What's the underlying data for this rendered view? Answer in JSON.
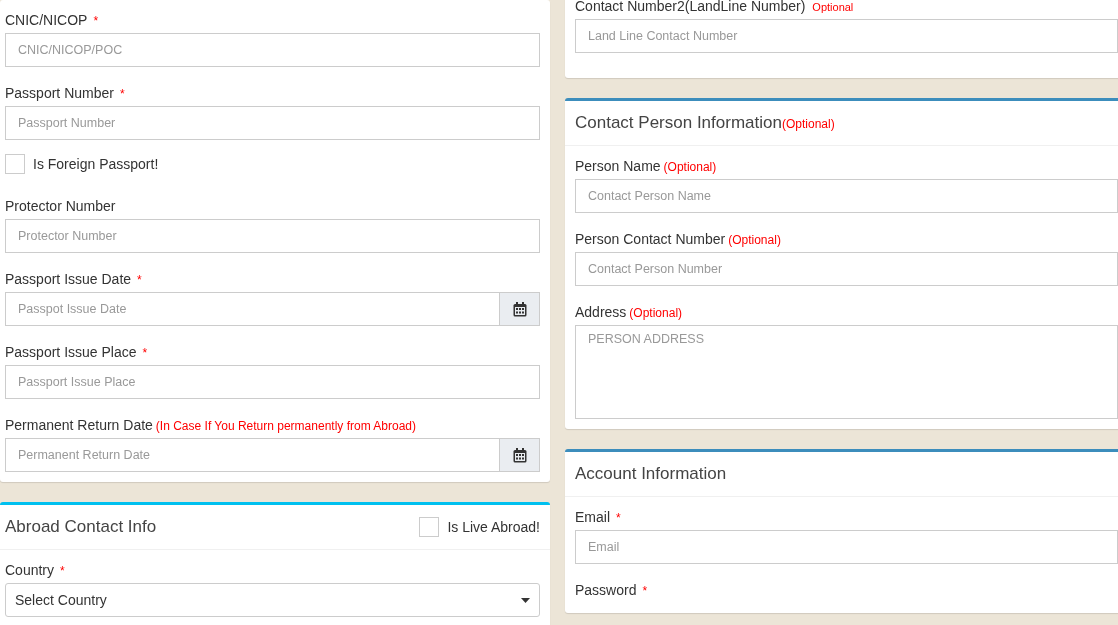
{
  "left_column": [
    {
      "kind": "plain",
      "fields": [
        {
          "kind": "text",
          "label": "CNIC/NICOP",
          "required_mark": "*",
          "placeholder": "CNIC/NICOP/POC"
        },
        {
          "kind": "text",
          "label": "Passport Number",
          "required_mark": "*",
          "placeholder": "Passport Number"
        },
        {
          "kind": "checkbox",
          "label": "Is Foreign Passport!",
          "checked": false
        },
        {
          "kind": "text",
          "label": "Protector Number",
          "placeholder": "Protector Number"
        },
        {
          "kind": "date",
          "label": "Passport Issue Date",
          "required_mark": "*",
          "placeholder": "Passpot Issue Date"
        },
        {
          "kind": "text",
          "label": "Passport Issue Place",
          "required_mark": "*",
          "placeholder": "Passport Issue Place"
        },
        {
          "kind": "date",
          "label": "Permanent Return Date",
          "note": "(In Case If You Return permanently from Abroad)",
          "placeholder": "Permanent Return Date"
        }
      ]
    },
    {
      "kind": "titled",
      "title": "Abroad Contact Info",
      "header_checkbox": {
        "label": "Is Live Abroad!",
        "checked": false
      },
      "fields": [
        {
          "kind": "select",
          "label": "Country",
          "required_mark": "*",
          "value": "Select Country"
        }
      ]
    }
  ],
  "right_column": [
    {
      "kind": "plain",
      "fields": [
        {
          "kind": "text",
          "label": "Contact Number2(LandLine Number)",
          "note": "Optional",
          "placeholder": "Land Line Contact Number"
        }
      ]
    },
    {
      "kind": "titled",
      "title": "Contact Person Information",
      "title_note": "(Optional)",
      "fields": [
        {
          "kind": "text",
          "label": "Person Name",
          "note": "(Optional)",
          "placeholder": "Contact Person Name"
        },
        {
          "kind": "text",
          "label": "Person Contact Number",
          "note": "(Optional)",
          "placeholder": "Contact Person Number"
        },
        {
          "kind": "textarea",
          "label": "Address",
          "note": "(Optional)",
          "placeholder": "PERSON ADDRESS"
        }
      ]
    },
    {
      "kind": "titled",
      "title": "Account Information",
      "fields": [
        {
          "kind": "text",
          "label": "Email",
          "required_mark": "*",
          "placeholder": "Email"
        },
        {
          "kind": "text",
          "label": "Password",
          "required_mark": "*"
        }
      ]
    }
  ]
}
